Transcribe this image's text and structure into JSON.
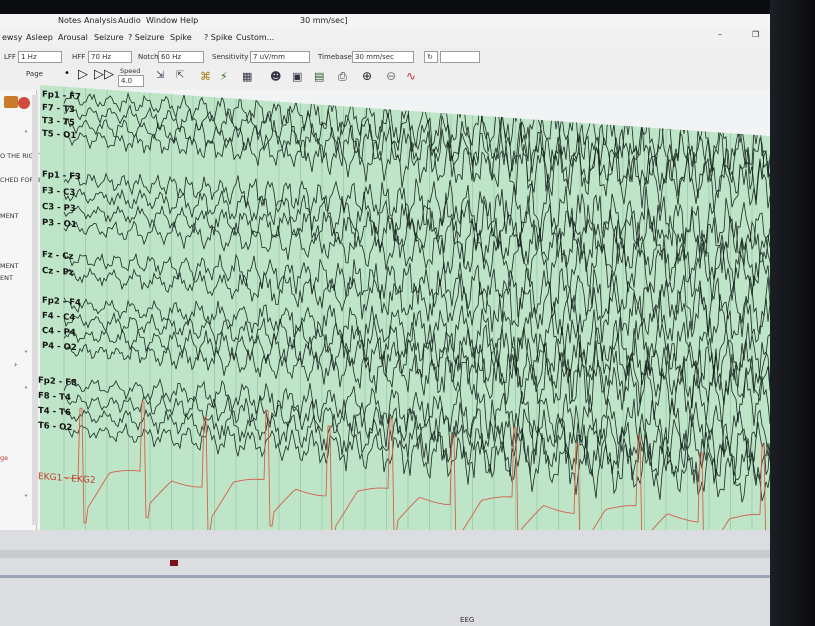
{
  "window": {
    "title_fragment": "30 mm/sec]",
    "menu": [
      "Notes",
      "Analysis",
      "Audio",
      "Window",
      "Help"
    ],
    "controls": {
      "restore": "❐",
      "close": "✕",
      "min2": "–",
      "restore2": "❐",
      "close2": "✕"
    }
  },
  "event_toolbar": {
    "buttons": [
      "ewsy",
      "Asleep",
      "Arousal",
      "Seizure",
      "? Seizure",
      "Spike",
      "? Spike",
      "Custom..."
    ]
  },
  "settings": {
    "lff_label": "LFF",
    "lff_value": "1 Hz",
    "hff_label": "HFF",
    "hff_value": "70 Hz",
    "notch_label": "Notch",
    "notch_value": "60 Hz",
    "sensitivity_label": "Sensitivity",
    "sensitivity_value": "7 uV/mm",
    "timebase_label": "Timebase",
    "timebase_value": "30 mm/sec"
  },
  "playback": {
    "page_label": "Page",
    "speed_label": "Speed",
    "speed_value": "4.0",
    "play_glyph": "▷",
    "fast_glyph": "▷▷"
  },
  "left_panel": {
    "notes": [
      "O THE RIGHT",
      "CHED FORHEA",
      "MENT",
      "MENT",
      "ENT",
      "ge"
    ]
  },
  "channels": [
    "Fp1 - F7",
    "F7 - T3",
    "T3 - T5",
    "T5 - O1",
    "Fp1 - F3",
    "F3 - C3",
    "C3 - P3",
    "P3 - O1",
    "Fz - Cz",
    "Cz - Pz",
    "Fp2 - F4",
    "F4 - C4",
    "C4 - P4",
    "P4 - O2",
    "Fp2 - F8",
    "F8 - T4",
    "T4 - T6",
    "T6 - O2"
  ],
  "ekg_label": "EKG1 - EKG2",
  "colors": {
    "eeg_background": "#bfe5c9",
    "eeg_trace": "#1a2a22",
    "ekg_trace": "#d2614a",
    "grid": "#8fbf9c"
  },
  "footer_text": "EEG"
}
